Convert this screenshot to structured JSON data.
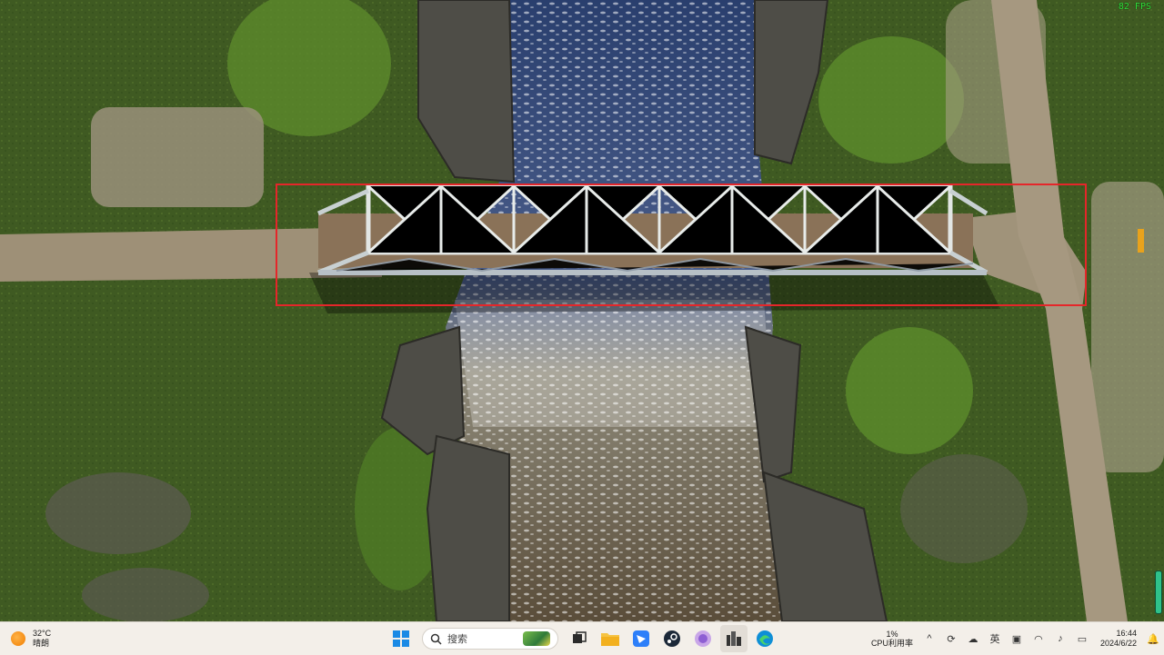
{
  "overlay": {
    "fps": "82 FPS"
  },
  "taskbar": {
    "weather": {
      "temp": "32°C",
      "condition": "晴朗"
    },
    "search": {
      "placeholder": "搜索"
    },
    "apps": [
      "windows-start",
      "search",
      "task-view",
      "file-explorer",
      "feishu",
      "steam",
      "browser-app",
      "cities-skylines",
      "edge"
    ],
    "cpu": {
      "value": "1%",
      "label": "CPU利用率"
    },
    "clock": {
      "time": "16:44",
      "date": "2024/6/22"
    }
  },
  "colors": {
    "selection": "#e5262a",
    "fps": "#2fe03a",
    "taskbar": "#f3efe9"
  }
}
